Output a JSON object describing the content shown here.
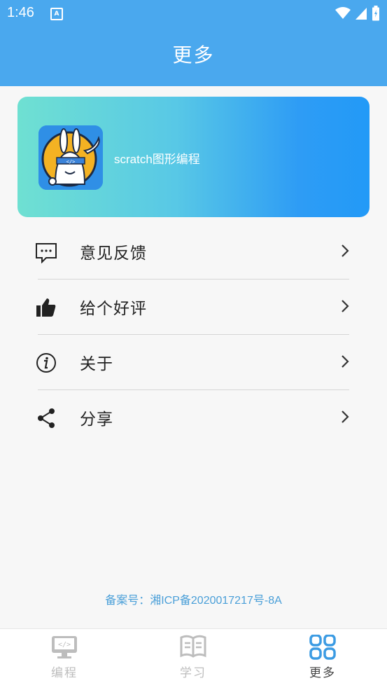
{
  "status_bar": {
    "time": "1:46",
    "notification_icon": "A",
    "icons": [
      "wifi-icon",
      "signal-icon",
      "battery-icon"
    ]
  },
  "header": {
    "title": "更多"
  },
  "banner": {
    "app_name": "scratch图形编程",
    "logo_icon": "rabbit-ninja-logo"
  },
  "menu": {
    "items": [
      {
        "label": "意见反馈",
        "icon": "feedback-chat-icon"
      },
      {
        "label": "给个好评",
        "icon": "thumbs-up-icon"
      },
      {
        "label": "关于",
        "icon": "info-icon"
      },
      {
        "label": "分享",
        "icon": "share-icon"
      }
    ]
  },
  "footer": {
    "icp": "备案号：湘ICP备2020017217号-8A"
  },
  "tabbar": {
    "tabs": [
      {
        "label": "编程",
        "icon": "code-monitor-icon",
        "active": false
      },
      {
        "label": "学习",
        "icon": "book-icon",
        "active": false
      },
      {
        "label": "更多",
        "icon": "grid-icon",
        "active": true
      }
    ]
  },
  "colors": {
    "primary": "#4aa8ee",
    "banner_gradient_start": "#6fe0d2",
    "banner_gradient_end": "#229af7",
    "icp_text": "#4a9fd8",
    "background": "#f7f7f7"
  }
}
